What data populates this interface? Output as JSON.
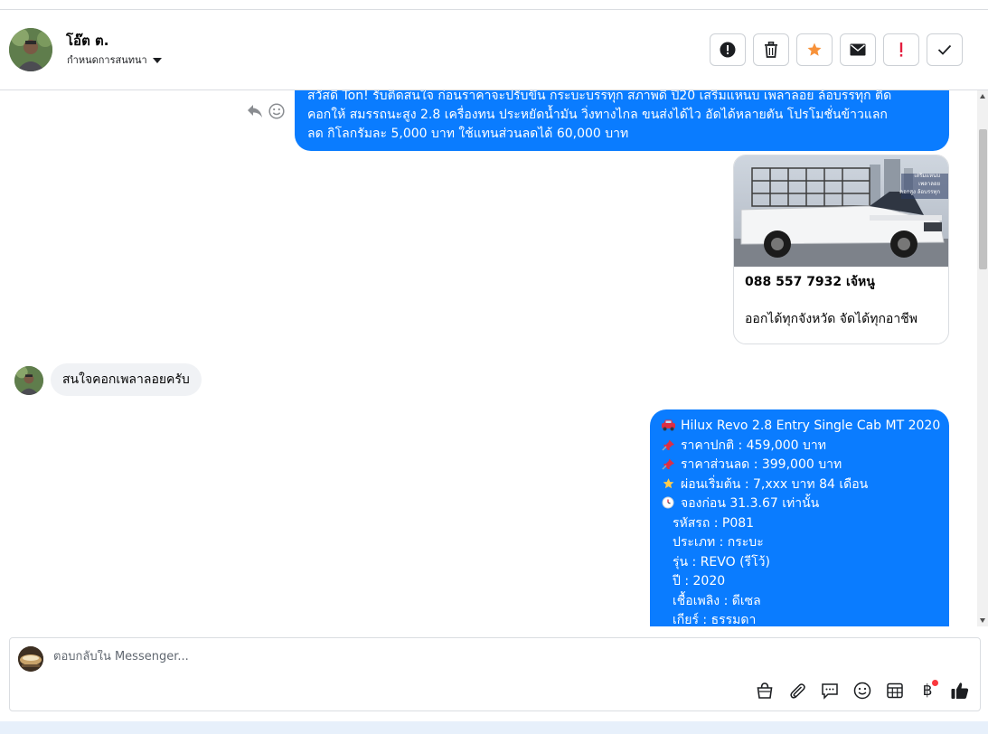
{
  "header": {
    "contact_name": "โอ๊ต ต.",
    "assign_label": "กำหนดการสนทนา"
  },
  "actions": [
    {
      "name": "mark-spam-button",
      "icon": "alert-circle-icon"
    },
    {
      "name": "delete-button",
      "icon": "trash-icon"
    },
    {
      "name": "star-button",
      "icon": "star-icon"
    },
    {
      "name": "mark-unread-button",
      "icon": "envelope-icon"
    },
    {
      "name": "follow-up-button",
      "icon": "exclamation-icon"
    },
    {
      "name": "mark-done-button",
      "icon": "check-icon"
    }
  ],
  "messages": {
    "msg1_lines": [
      "สวัสดี Ton! รับติดสนใจ ก่อนราคาจะปรับขึ้น กระบะบรรทุก สภาพดี ปี20 เสริมแหนบ เพลาลอย ล้อบรรทุก ติด",
      "คอกให้ สมรรถนะสูง 2.8 เครื่องทน ประหยัดน้ำมัน วิ่งทางไกล ขนส่งได้ไว อัดได้หลายตัน โปรโมชั่นข้าวแลก",
      "ลด กิโลกรัมละ 5,000 บาท ใช้แทนส่วนลดได้ 60,000 บาท"
    ],
    "card": {
      "image_caption_lines": [
        "เสริมแหนบ",
        "เพลาลอย",
        "คอกสูง ล้อบรรทุก"
      ],
      "title": "088 557 7932 เจ้หนู",
      "subtitle": "ออกได้ทุกจังหวัด จัดได้ทุกอาชีพ"
    },
    "incoming": "สนใจคอกเพลาลอยครับ",
    "msg2": {
      "line1": "Hilux Revo 2.8 Entry Single Cab MT 2020",
      "line2": "ราคาปกติ : 459,000 บาท",
      "line3": "ราคาส่วนลด : 399,000 บาท",
      "line4": "ผ่อนเริ่มต้น : 7,xxx บาท 84 เดือน",
      "line5": "จองก่อน 31.3.67 เท่านั้น",
      "line6": "รหัสรถ : P081",
      "line7": "ประเภท : กระบะ",
      "line8": "รุ่น : REVO (รีโว้)",
      "line9": "ปี : 2020",
      "line10": "เชื้อเพลิง : ดีเซล",
      "line11": "เกียร์ : ธรรมดา"
    }
  },
  "composer": {
    "placeholder": "ตอบกลับใน Messenger...",
    "baht_symbol": "฿"
  },
  "colors": {
    "outgoing_bubble": "#0a7cff",
    "incoming_bubble": "#f0f2f5",
    "star": "#f7923a",
    "follow_up": "#e41e3f"
  }
}
